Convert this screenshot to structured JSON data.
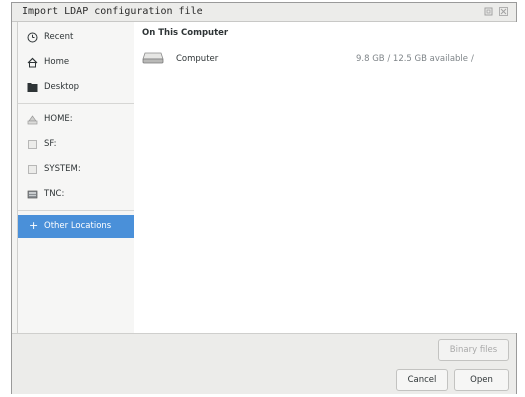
{
  "window": {
    "title": "Import LDAP configuration file"
  },
  "sidebar": {
    "items": [
      {
        "label": "Recent",
        "icon": "clock-icon"
      },
      {
        "label": "Home",
        "icon": "home-icon"
      },
      {
        "label": "Desktop",
        "icon": "folder-icon"
      },
      {
        "label": "HOME:",
        "icon": "drive-icon"
      },
      {
        "label": "SF:",
        "icon": "drive-icon"
      },
      {
        "label": "SYSTEM:",
        "icon": "drive-icon"
      },
      {
        "label": "TNC:",
        "icon": "drive-icon"
      },
      {
        "label": "Other Locations",
        "icon": "plus-icon"
      }
    ]
  },
  "main": {
    "section_title": "On This Computer",
    "location": {
      "name": "Computer",
      "available": "9.8 GB / 12.5 GB available",
      "path": "/"
    }
  },
  "footer": {
    "filter_label": "Binary files",
    "cancel_label": "Cancel",
    "open_label": "Open"
  },
  "colors": {
    "accent": "#4a90d9"
  }
}
